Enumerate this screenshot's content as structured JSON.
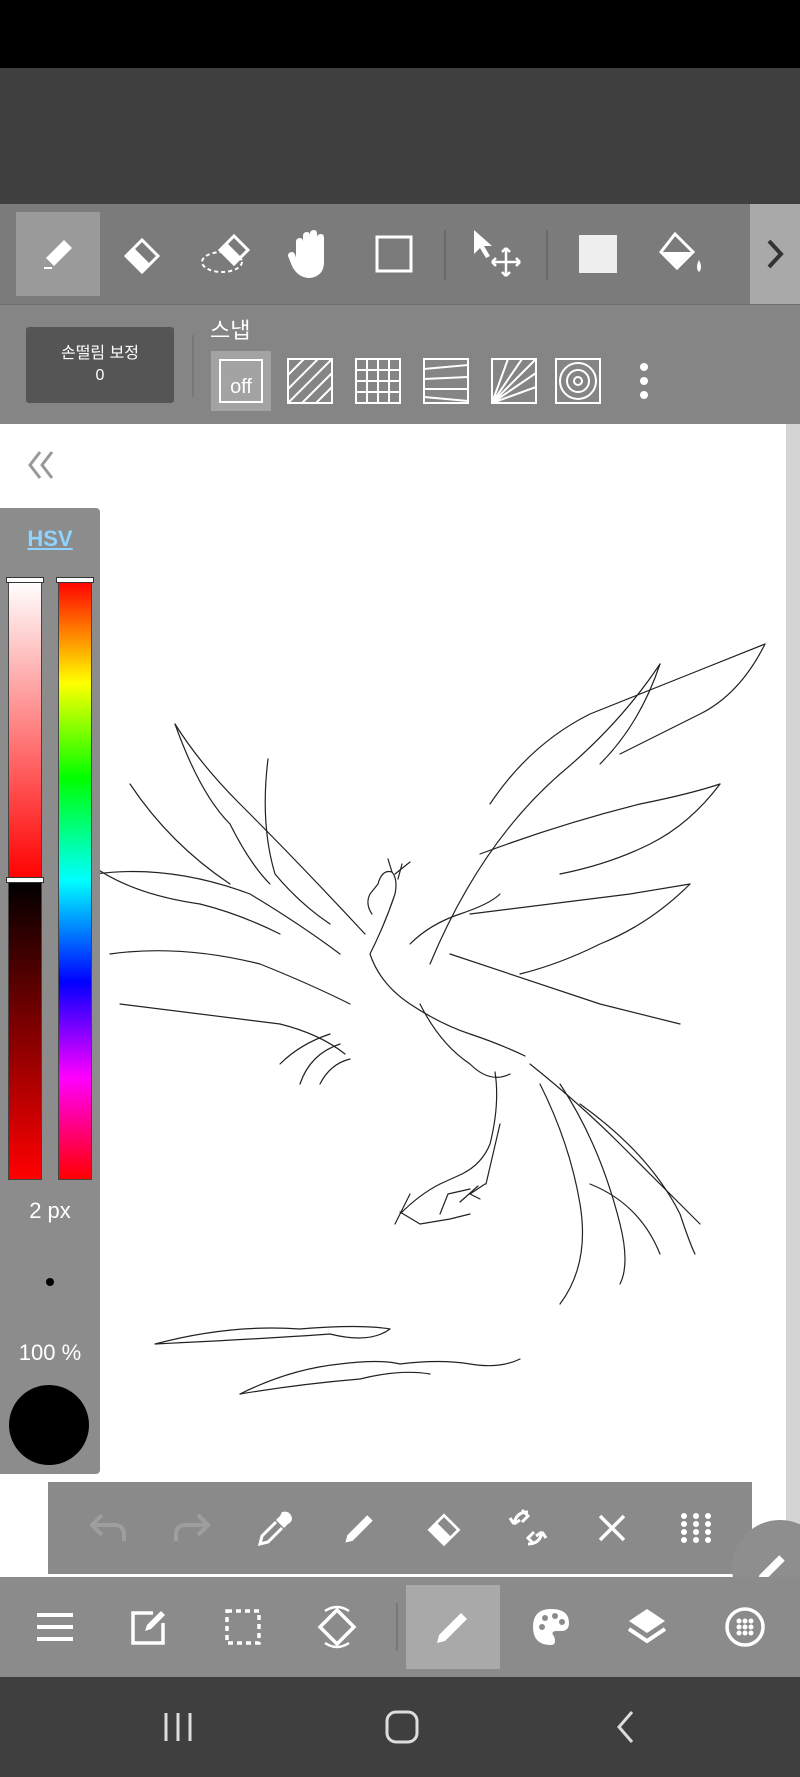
{
  "toolbar": {
    "tools": [
      "pen-tool",
      "eraser-tool",
      "lasso-eraser-tool",
      "hand-tool",
      "rectangle-tool",
      "move-tool",
      "fill-color-tool",
      "bucket-tool"
    ],
    "active_tool": "pen-tool"
  },
  "subbar": {
    "stabilizer_label": "손떨림 보정",
    "stabilizer_value": "0",
    "snap_label": "스냅",
    "snap_off_label": "off"
  },
  "color_panel": {
    "mode_label": "HSV",
    "brush_size": "2 px",
    "opacity": "100 %",
    "current_color": "#000000",
    "hue_handle_fraction": 0.0,
    "value_handle_fraction": 0.5
  },
  "quick_bar": {
    "items": [
      "undo-icon",
      "redo-icon",
      "eyedropper-icon",
      "pen-icon",
      "eraser-icon",
      "transform-icon",
      "clear-icon",
      "grid-menu-icon"
    ]
  },
  "bottom_bar": {
    "items": [
      "menu-icon",
      "edit-icon",
      "selection-icon",
      "rotate-view-icon",
      "brush-icon",
      "palette-icon",
      "layers-icon",
      "materials-icon"
    ],
    "active_item": "brush-icon"
  },
  "colors": {
    "toolbar_bg": "#7b7b7b",
    "accent_link": "#8fd3ff",
    "canvas": "#ffffff"
  }
}
